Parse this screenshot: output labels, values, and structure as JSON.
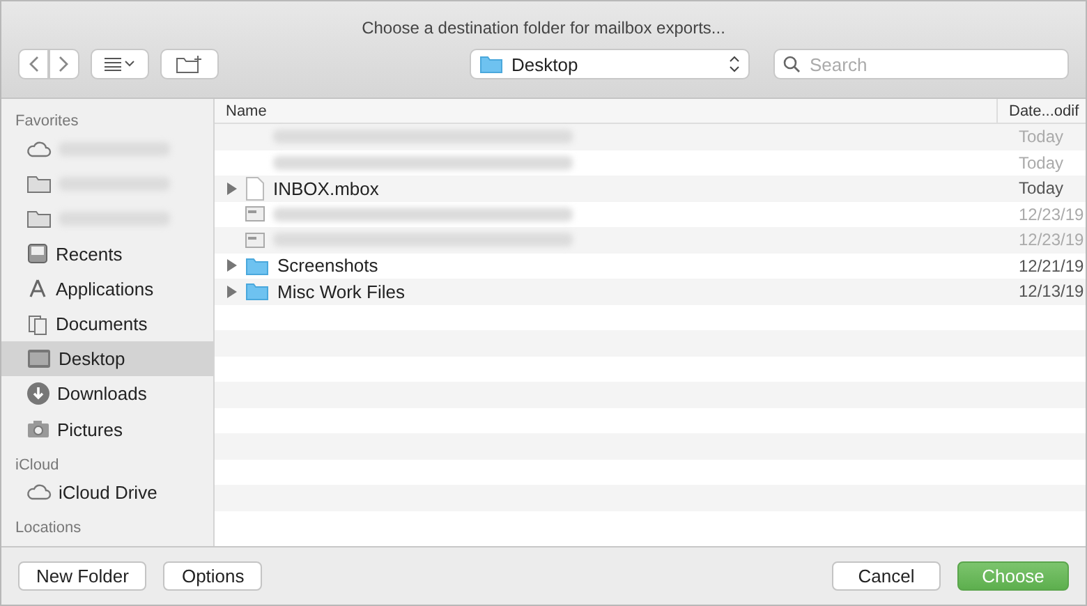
{
  "window": {
    "title": "Choose a destination folder for mailbox exports..."
  },
  "toolbar": {
    "location": "Desktop",
    "search": {
      "placeholder": "Search"
    }
  },
  "sidebar": {
    "sections": [
      {
        "title": "Favorites",
        "items": [
          {
            "kind": "blurred",
            "selected": false
          },
          {
            "kind": "blurred",
            "selected": false
          },
          {
            "kind": "blurred",
            "selected": false
          },
          {
            "kind": "item",
            "label": "Recents",
            "selected": false
          },
          {
            "kind": "item",
            "label": "Applications",
            "selected": false
          },
          {
            "kind": "item",
            "label": "Documents",
            "selected": false
          },
          {
            "kind": "item",
            "label": "Desktop",
            "selected": true
          },
          {
            "kind": "item",
            "label": "Downloads",
            "selected": false
          },
          {
            "kind": "item",
            "label": "Pictures",
            "selected": false
          }
        ]
      },
      {
        "title": "iCloud",
        "items": [
          {
            "kind": "item",
            "label": "iCloud Drive",
            "selected": false
          }
        ]
      },
      {
        "title": "Locations"
      }
    ]
  },
  "table": {
    "columns": [
      "Name",
      "Date...odif"
    ],
    "rows": [
      {
        "kind": "blurred",
        "expandable": false,
        "date": "Today",
        "disabled": true
      },
      {
        "kind": "blurred",
        "expandable": false,
        "date": "Today",
        "disabled": true
      },
      {
        "kind": "document",
        "expandable": true,
        "name": "INBOX.mbox",
        "date": "Today",
        "disabled": false
      },
      {
        "kind": "preview",
        "expandable": false,
        "date": "12/23/19",
        "disabled": true
      },
      {
        "kind": "preview",
        "expandable": false,
        "date": "12/23/19",
        "disabled": true
      },
      {
        "kind": "folder",
        "expandable": true,
        "name": "Screenshots",
        "date": "12/21/19",
        "disabled": false
      },
      {
        "kind": "folder",
        "expandable": true,
        "name": "Misc Work Files",
        "date": "12/13/19",
        "disabled": false
      }
    ]
  },
  "footer": {
    "left_buttons": [
      "New Folder",
      "Options"
    ],
    "cancel": "Cancel",
    "confirm": "Choose"
  }
}
